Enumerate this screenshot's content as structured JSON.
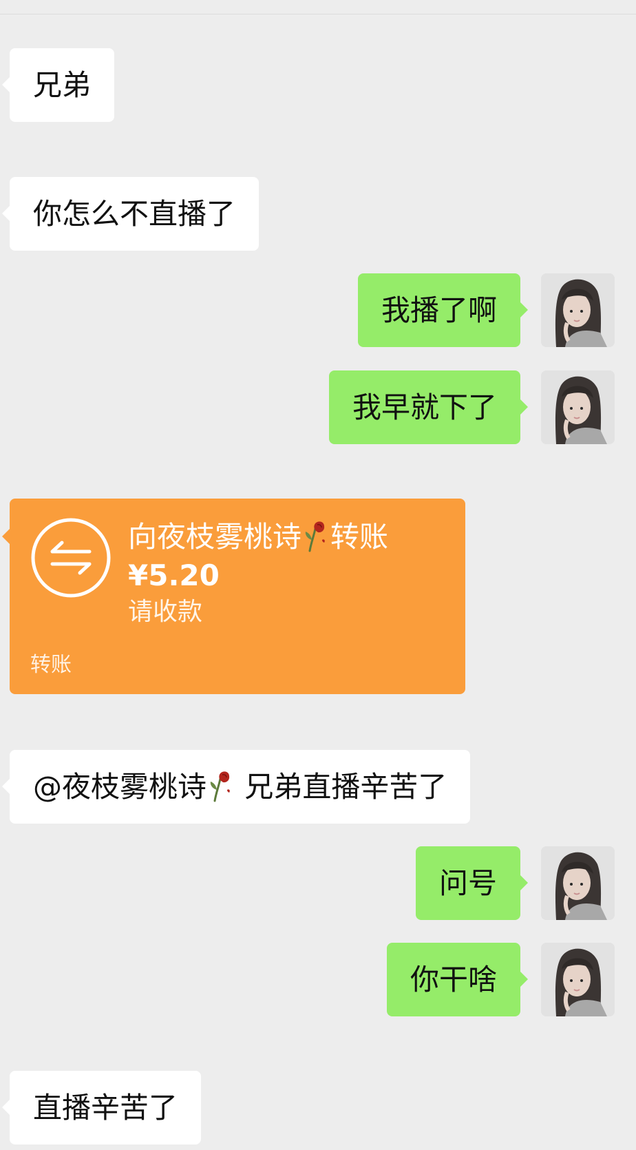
{
  "messages": [
    {
      "text": "兄弟"
    },
    {
      "text": "你怎么不直播了"
    },
    {
      "text": "我播了啊"
    },
    {
      "text": "我早就下了"
    },
    {
      "text": "兄弟直播辛苦了"
    },
    {
      "text": "问号"
    },
    {
      "text": "你干啥"
    },
    {
      "text": "直播辛苦了"
    }
  ],
  "transfer": {
    "title_prefix": "向夜枝雾桃诗",
    "title_suffix": "转账",
    "amount": "¥5.20",
    "status": "请收款",
    "footer": "转账",
    "color": "#fa9d3b"
  },
  "mention": {
    "text": "@夜枝雾桃诗"
  },
  "colors": {
    "background": "#ededed",
    "incoming_bubble": "#ffffff",
    "outgoing_bubble": "#95ec69"
  },
  "icons": {
    "transfer": "transfer-arrows-icon",
    "rose": "wilted-rose-icon"
  }
}
